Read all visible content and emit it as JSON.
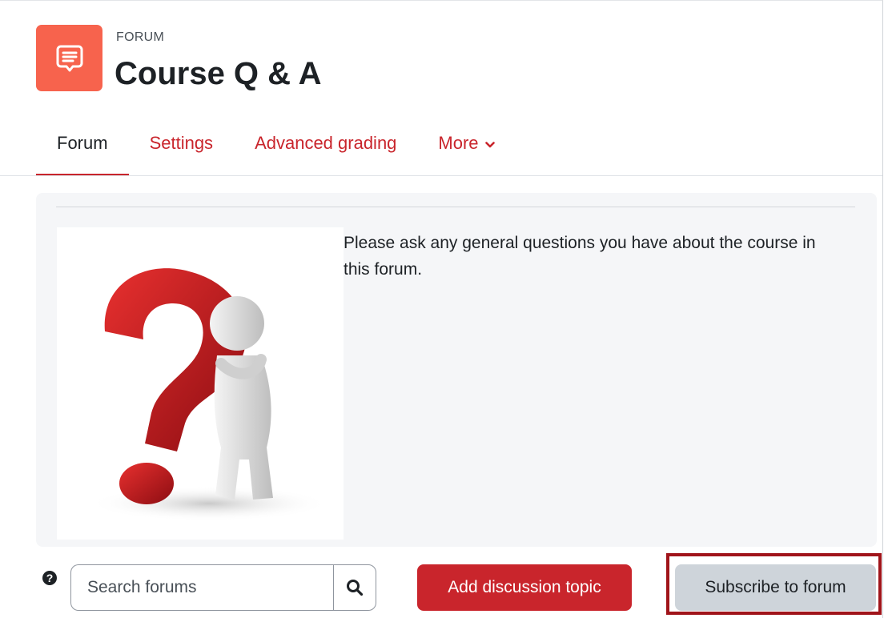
{
  "header": {
    "activity_type": "FORUM",
    "title": "Course Q & A",
    "icon": "forum-speech-bubble-icon",
    "icon_color": "#f7634d"
  },
  "tabs": [
    {
      "label": "Forum",
      "active": true
    },
    {
      "label": "Settings",
      "active": false
    },
    {
      "label": "Advanced grading",
      "active": false
    },
    {
      "label": "More",
      "active": false,
      "has_dropdown": true
    }
  ],
  "intro": {
    "image": "question-mark-figure-image",
    "text": "Please ask any general questions you have about the course in this forum."
  },
  "controls": {
    "help_icon": "?",
    "search_placeholder": "Search forums",
    "search_icon": "search-icon",
    "add_button_label": "Add discussion topic",
    "subscribe_button_label": "Subscribe to forum"
  },
  "colors": {
    "accent": "#c9252c",
    "highlight_border": "#a0141a",
    "secondary_button": "#ced4da"
  }
}
